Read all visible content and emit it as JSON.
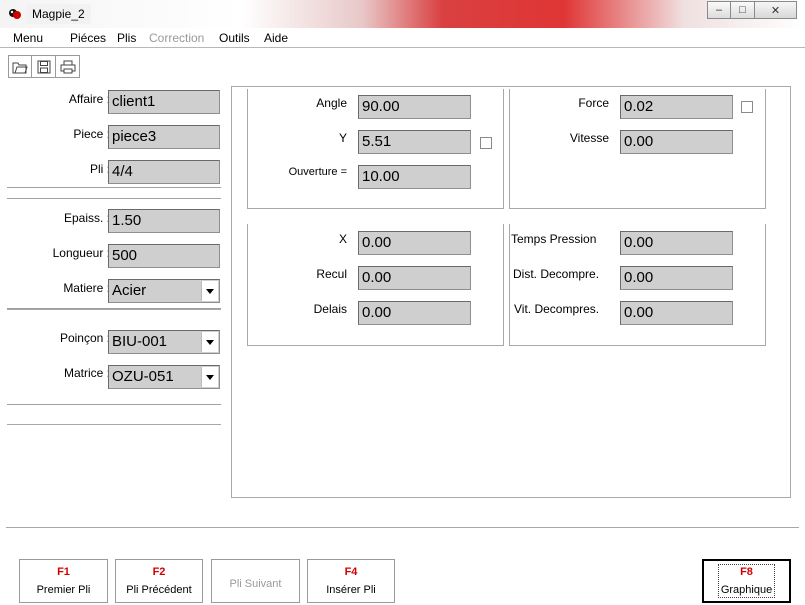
{
  "window": {
    "title": "Magpie_2",
    "controls": {
      "minimize": "–",
      "maximize": "□",
      "close": "✕"
    }
  },
  "menu": {
    "items": [
      "Menu",
      "Piéces",
      "Plis",
      "Correction",
      "Outils",
      "Aide"
    ],
    "disabled": [
      "Correction"
    ]
  },
  "toolbar": {
    "icons": [
      "open-folder-icon",
      "save-icon",
      "print-icon"
    ]
  },
  "part": {
    "affaire_label": "Affaire :",
    "affaire_value": "client1",
    "piece_label": "Piece :",
    "piece_value": "piece3",
    "pli_label": "Pli :",
    "pli_value": "4/4"
  },
  "material": {
    "epaiss_label": "Epaiss. :",
    "epaiss_value": "1.50",
    "longueur_label": "Longueur :",
    "longueur_value": "500",
    "matiere_label": "Matiere :",
    "matiere_value": "Acier"
  },
  "tooling": {
    "poincon_label": "Poinçon :",
    "poincon_value": "BIU-001",
    "matrice_label": "Matrice :",
    "matrice_value": "OZU-051"
  },
  "bend": {
    "angle_label": "Angle",
    "angle_value": "90.00",
    "y_label": "Y",
    "y_value": "5.51",
    "ouverture_label": "Ouverture =",
    "ouverture_value": "10.00",
    "force_label": "Force",
    "force_value": "0.02",
    "vitesse_label": "Vitesse",
    "vitesse_value": "0.00"
  },
  "backgauge": {
    "x_label": "X",
    "x_value": "0.00",
    "recul_label": "Recul",
    "recul_value": "0.00",
    "delais_label": "Delais",
    "delais_value": "0.00",
    "temps_label": "Temps Pression",
    "temps_value": "0.00",
    "dist_label": "Dist. Decompre.",
    "dist_value": "0.00",
    "vit_label": "Vit. Decompres.",
    "vit_value": "0.00"
  },
  "fkeys": [
    {
      "key": "F1",
      "label": "Premier Pli"
    },
    {
      "key": "F2",
      "label": "Pli Précédent"
    },
    {
      "key": "",
      "label": "Pli Suivant"
    },
    {
      "key": "F4",
      "label": "Insérer Pli"
    },
    {
      "key": "F8",
      "label": "Graphique"
    }
  ]
}
